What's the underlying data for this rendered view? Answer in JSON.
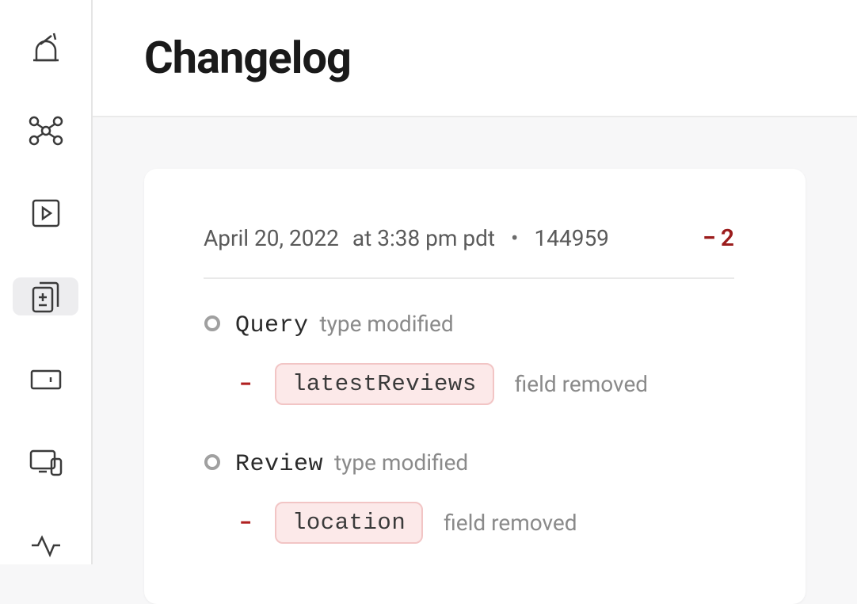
{
  "header": {
    "title": "Changelog"
  },
  "entry": {
    "date": "April 20, 2022",
    "time": "at 3:38 pm pdt",
    "id": "144959",
    "removed_count": "2"
  },
  "changes": [
    {
      "type_name": "Query",
      "type_suffix": "type modified",
      "field_name": "latestReviews",
      "field_suffix": "field removed"
    },
    {
      "type_name": "Review",
      "type_suffix": "type modified",
      "field_name": "location",
      "field_suffix": "field removed"
    }
  ]
}
